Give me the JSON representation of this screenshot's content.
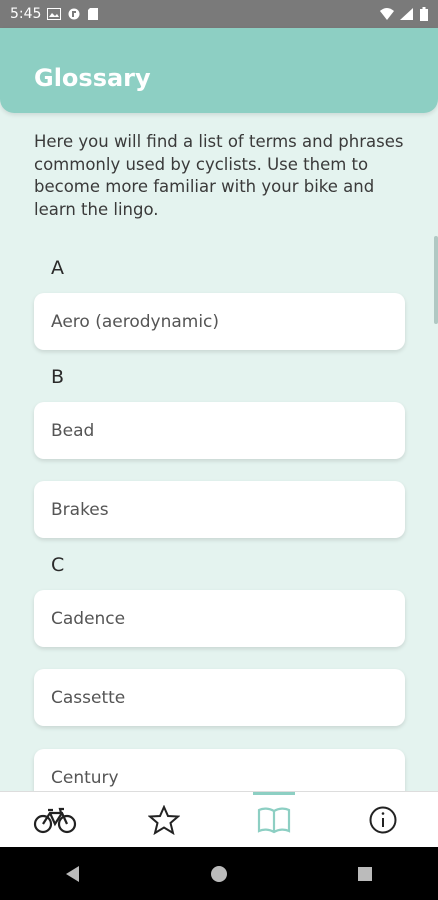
{
  "status_bar": {
    "time": "5:45"
  },
  "header": {
    "title": "Glossary"
  },
  "intro": "Here you will find a list of terms and phrases commonly used by cyclists. Use them to become more familiar with your bike and learn the lingo.",
  "sections": [
    {
      "letter": "A",
      "terms": [
        "Aero (aerodynamic)"
      ]
    },
    {
      "letter": "B",
      "terms": [
        "Bead",
        "Brakes"
      ]
    },
    {
      "letter": "C",
      "terms": [
        "Cadence",
        "Cassette",
        "Century"
      ]
    }
  ],
  "bottom_nav": {
    "items": [
      {
        "icon": "bike-icon",
        "active": false
      },
      {
        "icon": "star-icon",
        "active": false
      },
      {
        "icon": "book-icon",
        "active": true
      },
      {
        "icon": "info-icon",
        "active": false
      }
    ],
    "accent": "#8dcfc3"
  },
  "colors": {
    "background": "#e4f3ef",
    "header": "#8dcfc3"
  }
}
